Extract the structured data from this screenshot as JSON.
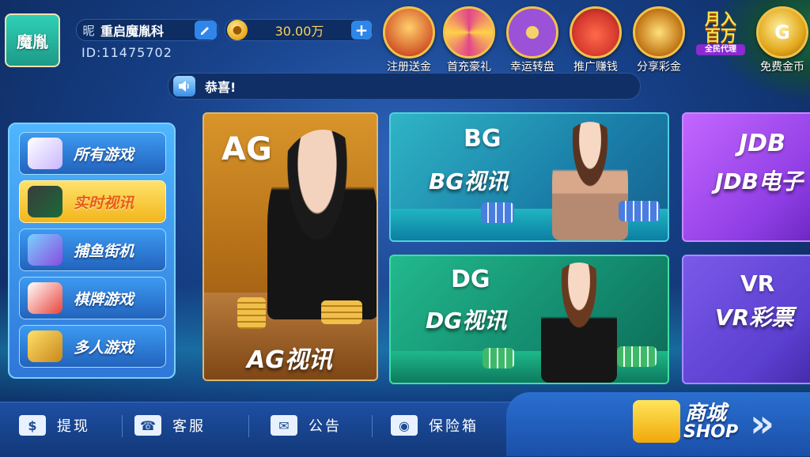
{
  "header": {
    "logo_text": "魔胤",
    "nickname_tag": "昵",
    "nickname": "重启魔胤科",
    "user_id": "ID:11475702",
    "coins": "30.00万",
    "plus_label": "+"
  },
  "top_icons": [
    {
      "label": "注册送金",
      "icon": "treasure-chest-icon",
      "color": "#d4592a"
    },
    {
      "label": "首充豪礼",
      "icon": "prize-wheel-icon",
      "color": "#e2468a"
    },
    {
      "label": "幸运转盘",
      "icon": "lucky-wheel-icon",
      "color": "#9b52d6"
    },
    {
      "label": "推广赚钱",
      "icon": "money-bag-icon",
      "color": "#d63a2f"
    },
    {
      "label": "分享彩金",
      "icon": "gold-chest-icon",
      "color": "#c57a1a"
    },
    {
      "label": "免费金币",
      "icon": "gold-coin-icon",
      "color": "#e2a81c"
    }
  ],
  "promo_badge": {
    "line1": "月入",
    "line2": "百万",
    "line3": "全民代理"
  },
  "notice": {
    "text": "恭喜!"
  },
  "menu": [
    {
      "label": "所有游戏",
      "icon": "playing-cards-icon",
      "active": false
    },
    {
      "label": "实时视讯",
      "icon": "live-video-icon",
      "active": true
    },
    {
      "label": "捕鱼街机",
      "icon": "fish-icon",
      "active": false
    },
    {
      "label": "棋牌游戏",
      "icon": "mahjong-icon",
      "active": false
    },
    {
      "label": "多人游戏",
      "icon": "trophy-icon",
      "active": false
    }
  ],
  "cards": {
    "ag": {
      "logo": "AG",
      "title": "AG视讯"
    },
    "bg": {
      "logo": "BG",
      "title": "BG视讯"
    },
    "dg": {
      "logo": "DG",
      "title": "DG视讯"
    },
    "jdb": {
      "logo": "JDB",
      "title": "JDB电子"
    },
    "vr": {
      "logo": "VR",
      "title": "VR彩票"
    }
  },
  "bottom": {
    "withdraw": "提现",
    "service": "客服",
    "announcement": "公告",
    "safe": "保险箱",
    "shop_cn": "商城",
    "shop_en": "SHOP"
  }
}
